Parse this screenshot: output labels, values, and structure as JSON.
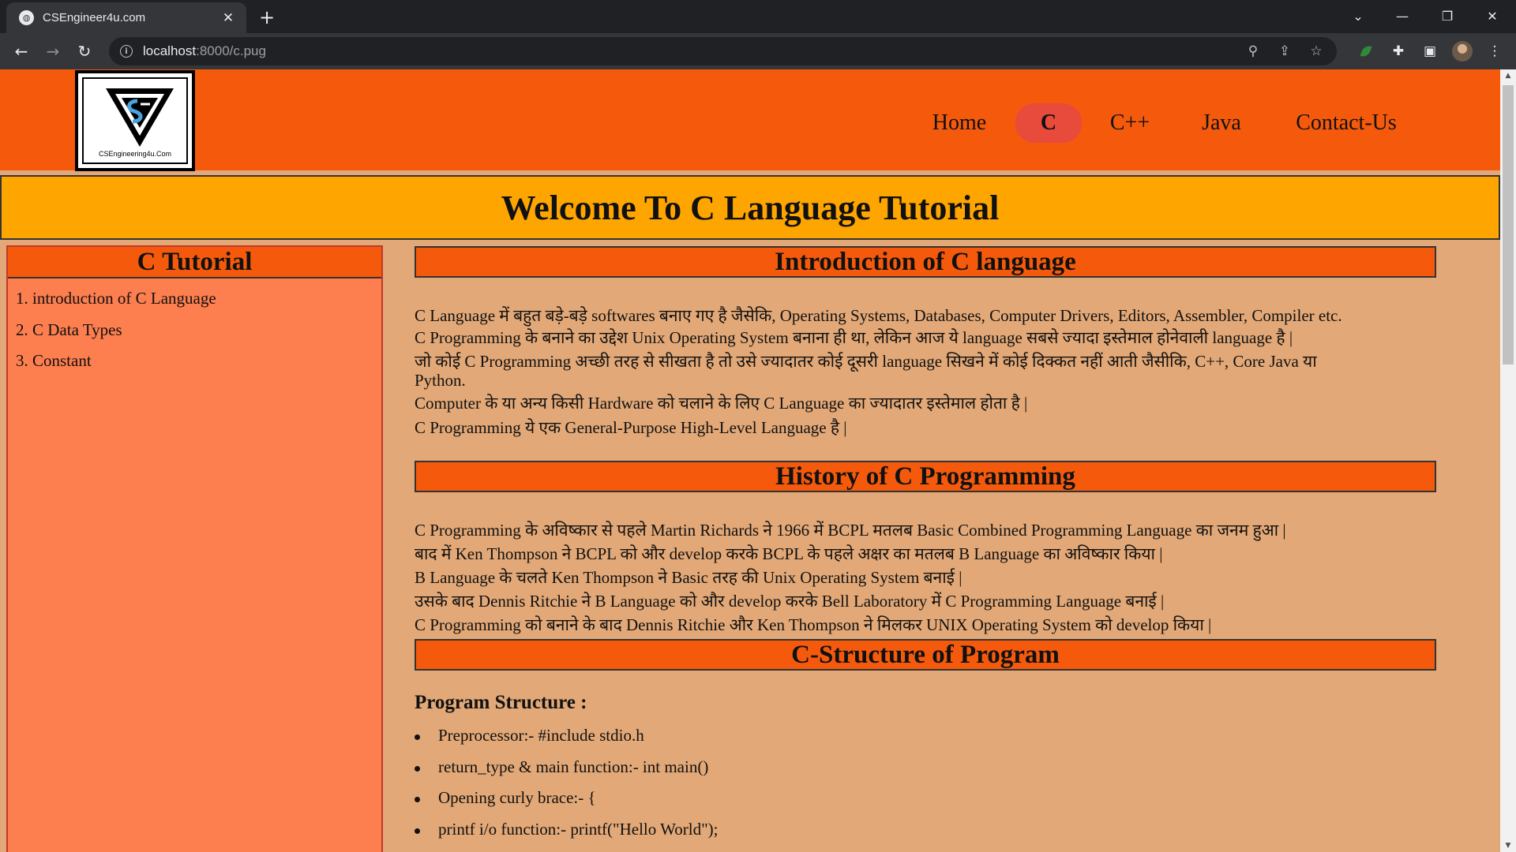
{
  "browser": {
    "tab_title": "CSEngineer4u.com",
    "tab_close": "✕",
    "new_tab": "+",
    "url_host": "localhost",
    "url_path": ":8000/c.pug",
    "icons": [
      "globe-icon",
      "back-arrow-icon",
      "forward-arrow-icon",
      "reload-icon",
      "info-icon",
      "zoom-icon",
      "share-icon",
      "star-icon",
      "puzzle-icon",
      "sidepanel-icon",
      "menu-icon"
    ]
  },
  "header": {
    "logo_text": "CSEngineering4u.Com",
    "nav": [
      "Home",
      "C",
      "C++",
      "Java",
      "Contact-Us"
    ],
    "active_nav": "C",
    "colors": {
      "header_bg": "#f55a0c",
      "active_nav_bg": "#e84a3c"
    }
  },
  "banner": {
    "title": "Welcome To C Language Tutorial"
  },
  "sidebar": {
    "title": "C Tutorial",
    "items": [
      "1. introduction of C Language",
      "2. C Data Types",
      "3. Constant"
    ]
  },
  "sections": {
    "intro": {
      "heading": "Introduction of C language",
      "lines": [
        "C Language में बहुत बड़े-बड़े softwares बनाए गए है जैसेकि, Operating Systems, Databases, Computer Drivers, Editors, Assembler, Compiler etc.",
        "C Programming के बनाने का उद्देश Unix Operating System बनाना ही था, लेकिन आज ये language सबसे ज्यादा इस्तेमाल होनेवाली language है |",
        "जो कोई C Programming अच्छी तरह से सीखता है तो उसे ज्यादातर कोई दूसरी language सिखने में कोई दिक्कत नहीं आती जैसीकि, C++, Core Java या",
        "Python.",
        "Computer के या अन्य किसी Hardware को चलाने के लिए C Language का ज्यादातर इस्तेमाल होता है |",
        "C Programming ये एक General-Purpose High-Level Language है |"
      ]
    },
    "history": {
      "heading": "History of C Programming",
      "lines": [
        "C Programming के अविष्कार से पहले Martin Richards ने 1966 में BCPL मतलब Basic Combined Programming Language का जनम हुआ |",
        "बाद में Ken Thompson ने BCPL को और develop करके BCPL के पहले अक्षर का मतलब B Language का अविष्कार किया |",
        "B Language के चलते Ken Thompson ने Basic तरह की Unix Operating System बनाई |",
        "उसके बाद Dennis Ritchie ने B Language को और develop करके Bell Laboratory में C Programming Language बनाई |",
        "C Programming को बनाने के बाद Dennis Ritchie और Ken Thompson ने मिलकर UNIX Operating System को develop किया |"
      ]
    },
    "structure": {
      "heading": "C-Structure of Program",
      "subtitle": "Program Structure :",
      "items": [
        "Preprocessor:- #include stdio.h",
        "return_type & main function:- int main()",
        "Opening curly brace:- {",
        "printf i/o function:- printf(\"Hello World\");"
      ]
    }
  }
}
